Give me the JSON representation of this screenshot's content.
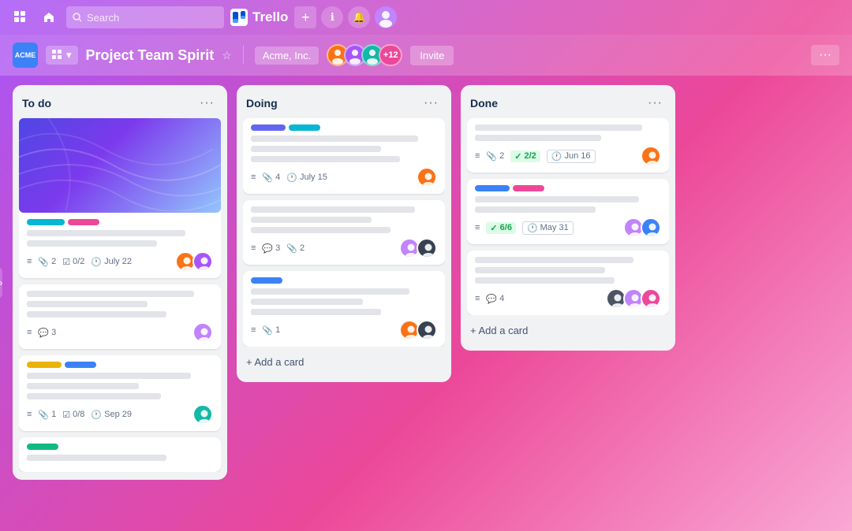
{
  "app": {
    "name": "Trello"
  },
  "topnav": {
    "search_placeholder": "Search",
    "plus_label": "+",
    "info_label": "ℹ",
    "bell_label": "🔔"
  },
  "boardheader": {
    "acme_label": "ACME",
    "workspace_label": "▦",
    "workspace_dropdown": "▾",
    "board_title": "Project Team Spirit",
    "workspace_name": "Acme, Inc.",
    "avatar_count": "+12",
    "invite_label": "Invite",
    "more_label": "···"
  },
  "columns": [
    {
      "id": "todo",
      "title": "To do",
      "cards": [
        {
          "id": "card-1",
          "has_cover": true,
          "labels": [
            {
              "color": "#06b6d4",
              "width": 48
            },
            {
              "color": "#ec4899",
              "width": 36
            }
          ],
          "lines": [
            {
              "w": "85%"
            },
            {
              "w": "70%"
            }
          ],
          "meta": {
            "menu_icon": "≡",
            "attachments": "2",
            "checklist": "0/2",
            "due": "July 22"
          },
          "avatars": [
            "orange",
            "purple"
          ]
        },
        {
          "id": "card-2",
          "has_cover": false,
          "labels": [],
          "lines": [
            {
              "w": "90%"
            },
            {
              "w": "65%"
            },
            {
              "w": "75%"
            }
          ],
          "meta": {
            "menu_icon": "≡",
            "comments": "3"
          },
          "avatars": [
            "lightpurple"
          ]
        },
        {
          "id": "card-3",
          "has_cover": false,
          "labels": [
            {
              "color": "#eab308",
              "width": 44
            },
            {
              "color": "#3b82f6",
              "width": 36
            }
          ],
          "lines": [
            {
              "w": "88%"
            },
            {
              "w": "60%"
            },
            {
              "w": "72%"
            }
          ],
          "meta": {
            "menu_icon": "≡",
            "attachments": "1",
            "checklist": "0/8",
            "due": "Sep 29"
          },
          "avatars": [
            "teal"
          ]
        },
        {
          "id": "card-4",
          "has_cover": false,
          "labels": [
            {
              "color": "#10b981",
              "width": 40
            }
          ],
          "lines": [
            {
              "w": "75%"
            }
          ],
          "meta": {},
          "avatars": []
        }
      ]
    },
    {
      "id": "doing",
      "title": "Doing",
      "cards": [
        {
          "id": "card-5",
          "has_cover": false,
          "labels": [
            {
              "color": "#6366f1",
              "width": 44
            },
            {
              "color": "#06b6d4",
              "width": 36
            }
          ],
          "lines": [
            {
              "w": "90%"
            },
            {
              "w": "70%"
            },
            {
              "w": "80%"
            }
          ],
          "meta": {
            "menu_icon": "≡",
            "attachments": "4",
            "due": "July 15"
          },
          "avatars": [
            "orange"
          ]
        },
        {
          "id": "card-6",
          "has_cover": false,
          "labels": [],
          "lines": [
            {
              "w": "88%"
            },
            {
              "w": "65%"
            },
            {
              "w": "75%"
            }
          ],
          "meta": {
            "menu_icon": "≡",
            "comments": "3",
            "attachments": "2"
          },
          "avatars": [
            "lightpurple",
            "dark"
          ]
        },
        {
          "id": "card-7",
          "has_cover": false,
          "labels": [
            {
              "color": "#3b82f6",
              "width": 40
            }
          ],
          "lines": [
            {
              "w": "85%"
            },
            {
              "w": "60%"
            },
            {
              "w": "70%"
            }
          ],
          "meta": {
            "menu_icon": "≡",
            "attachments": "1"
          },
          "avatars": [
            "orange",
            "dark"
          ]
        }
      ]
    },
    {
      "id": "done",
      "title": "Done",
      "cards": [
        {
          "id": "card-8",
          "has_cover": false,
          "labels": [],
          "lines": [
            {
              "w": "90%"
            },
            {
              "w": "68%"
            }
          ],
          "meta": {
            "menu_icon": "≡",
            "attachments": "2",
            "checklist_done": "2/2",
            "due_done": "Jun 16"
          },
          "avatars": [
            "orange"
          ]
        },
        {
          "id": "card-9",
          "has_cover": false,
          "labels": [
            {
              "color": "#3b82f6",
              "width": 44
            },
            {
              "color": "#ec4899",
              "width": 36
            }
          ],
          "lines": [
            {
              "w": "88%"
            },
            {
              "w": "65%"
            }
          ],
          "meta": {
            "menu_icon": "≡",
            "checklist_done": "6/6",
            "due_done": "May 31"
          },
          "avatars": [
            "lightpurple",
            "blue"
          ]
        },
        {
          "id": "card-10",
          "has_cover": false,
          "labels": [],
          "lines": [
            {
              "w": "85%"
            },
            {
              "w": "70%"
            },
            {
              "w": "75%"
            }
          ],
          "meta": {
            "menu_icon": "≡",
            "comments": "4"
          },
          "avatars": [
            "dark2",
            "lightpurple",
            "pink"
          ]
        }
      ]
    }
  ],
  "add_card_label": "+ Add a card",
  "colors": {
    "background_start": "#a855f7",
    "background_end": "#ec4899"
  }
}
